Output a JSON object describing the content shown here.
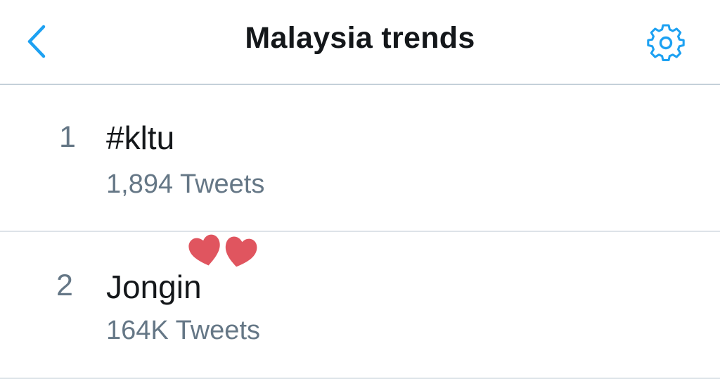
{
  "header": {
    "title": "Malaysia trends",
    "back_icon": "chevron-left-icon",
    "settings_icon": "gear-icon",
    "accent_color": "#1da1f2"
  },
  "trends": [
    {
      "rank": "1",
      "name": "#kltu",
      "tweets": "1,894 Tweets"
    },
    {
      "rank": "2",
      "name": "Jongin",
      "tweets": "164K Tweets"
    }
  ],
  "colors": {
    "primary_text": "#14171a",
    "secondary_text": "#657786",
    "divider": "#dde3e8",
    "heart": "#e0555f"
  }
}
